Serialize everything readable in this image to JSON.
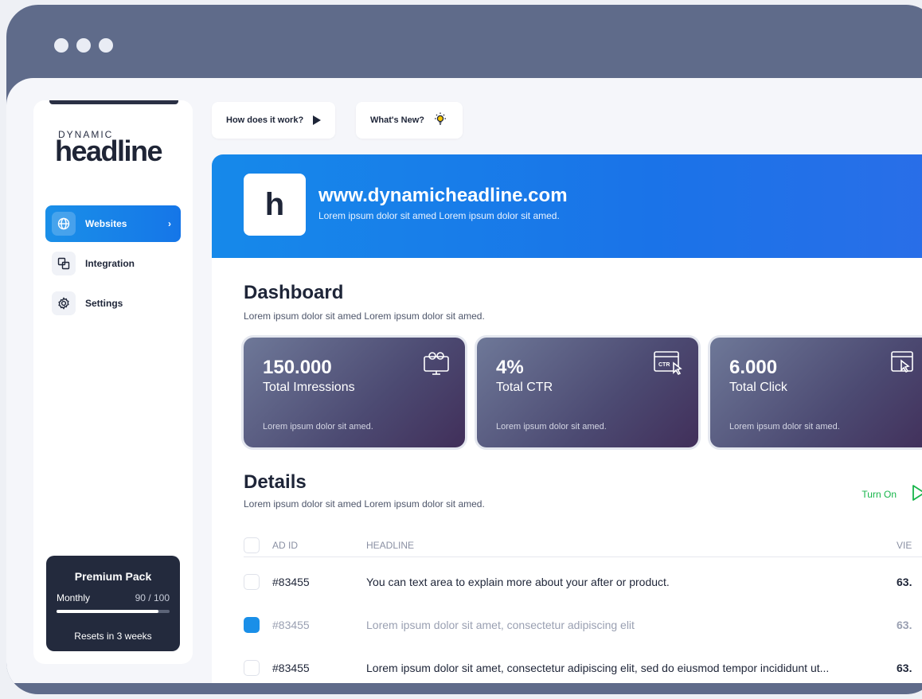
{
  "logo": {
    "small": "DYNAMIC",
    "big": "headline"
  },
  "sidebar": {
    "items": [
      {
        "label": "Websites",
        "active": true
      },
      {
        "label": "Integration",
        "active": false
      },
      {
        "label": "Settings",
        "active": false
      }
    ]
  },
  "premium": {
    "title": "Premium Pack",
    "period": "Monthly",
    "count": "90 / 100",
    "used_fraction": 0.9,
    "reset": "Resets in 3 weeks"
  },
  "topbar": {
    "how_label": "How does it work?",
    "new_label": "What's New?"
  },
  "banner": {
    "logo_letter": "h",
    "title": "www.dynamicheadline.com",
    "subtitle": "Lorem ipsum dolor sit amed Lorem ipsum dolor sit amed."
  },
  "dashboard": {
    "title": "Dashboard",
    "subtitle": "Lorem ipsum dolor sit amed Lorem ipsum dolor sit amed.",
    "cards": [
      {
        "value": "150.000",
        "label": "Total Imressions",
        "sub": "Lorem ipsum dolor sit amed."
      },
      {
        "value": "4%",
        "label": "Total CTR",
        "sub": "Lorem ipsum dolor sit amed.",
        "icon_text": "CTR"
      },
      {
        "value": "6.000",
        "label": "Total Click",
        "sub": "Lorem ipsum dolor sit amed."
      }
    ]
  },
  "details": {
    "title": "Details",
    "subtitle": "Lorem ipsum dolor sit amed Lorem ipsum dolor sit amed.",
    "turn_on": "Turn On",
    "columns": [
      "AD ID",
      "HEADLINE",
      "VIE"
    ],
    "rows": [
      {
        "id": "#83455",
        "headline": "You can text area to explain more about your after or product.",
        "views": "63.",
        "checked": false
      },
      {
        "id": "#83455",
        "headline": "Lorem ipsum dolor sit amet, consectetur adipiscing elit",
        "views": "63.",
        "checked": true
      },
      {
        "id": "#83455",
        "headline": "Lorem ipsum dolor sit amet, consectetur adipiscing elit, sed do eiusmod tempor incididunt ut...",
        "views": "63.",
        "checked": false
      }
    ]
  },
  "colors": {
    "accent": "#1a8fe8",
    "dark": "#232a3d",
    "success": "#17b54a"
  }
}
